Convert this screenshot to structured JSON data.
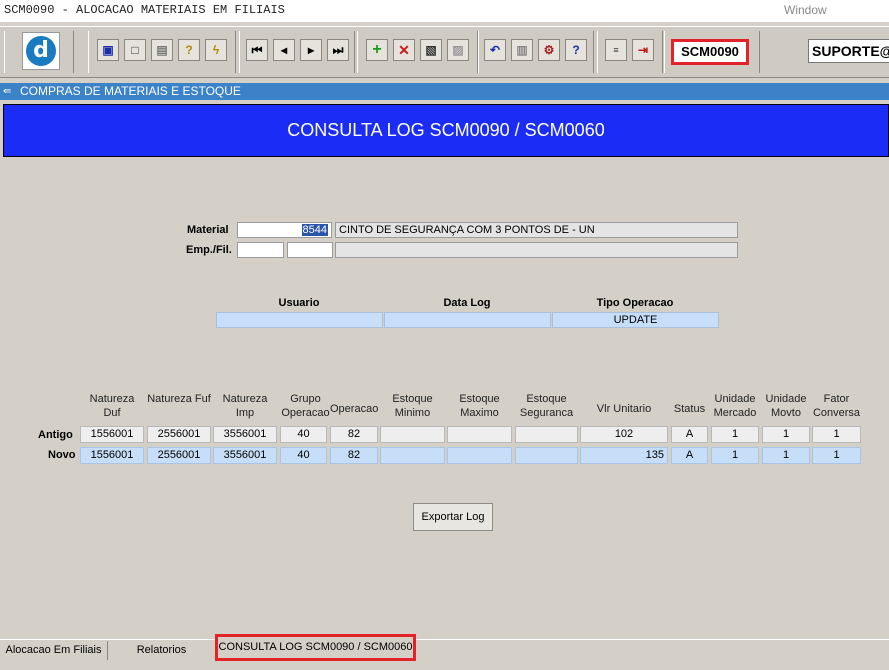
{
  "window": {
    "title": "SCM0090 - ALOCACAO MATERIAIS EM FILIAIS",
    "menu": "Window"
  },
  "toolbar": {
    "logo_glyph": "d",
    "program_code": "SCM0090",
    "user": "SUPORTE@"
  },
  "module": {
    "label": "COMPRAS DE MATERIAIS E ESTOQUE"
  },
  "header": {
    "title": "CONSULTA LOG SCM0090 / SCM0060"
  },
  "form": {
    "material_label": "Material",
    "material_code": "8544",
    "material_desc": "CINTO DE SEGURANÇA COM 3 PONTOS DE  - UN",
    "empfil_label": "Emp./Fil.",
    "usuario_label": "Usuario",
    "datalog_label": "Data Log",
    "tipo_label": "Tipo Operacao",
    "usuario_value": "",
    "datalog_value": "",
    "tipo_value": "UPDATE"
  },
  "grid": {
    "headers": [
      "Natureza Duf",
      "Natureza Fuf",
      "Natureza Imp",
      "Grupo Operacao",
      "Operacao",
      "Estoque Minimo",
      "Estoque Maximo",
      "Estoque Seguranca",
      "Vlr Unitario",
      "Status",
      "Unidade Mercado",
      "Unidade Movto",
      "Fator Conversa"
    ],
    "antigo_label": "Antigo",
    "novo_label": "Novo",
    "antigo": [
      "1556001",
      "2556001",
      "3556001",
      "40",
      "82",
      "",
      "",
      "",
      "102",
      "A",
      "1",
      "1",
      "1"
    ],
    "novo": [
      "1556001",
      "2556001",
      "3556001",
      "40",
      "82",
      "",
      "",
      "",
      "135",
      "A",
      "1",
      "1",
      "1"
    ]
  },
  "actions": {
    "export_label": "Exportar Log"
  },
  "tabs": [
    "Alocacao Em Filiais",
    "Relatorios",
    "CONSULTA LOG SCM0090 / SCM0060"
  ]
}
